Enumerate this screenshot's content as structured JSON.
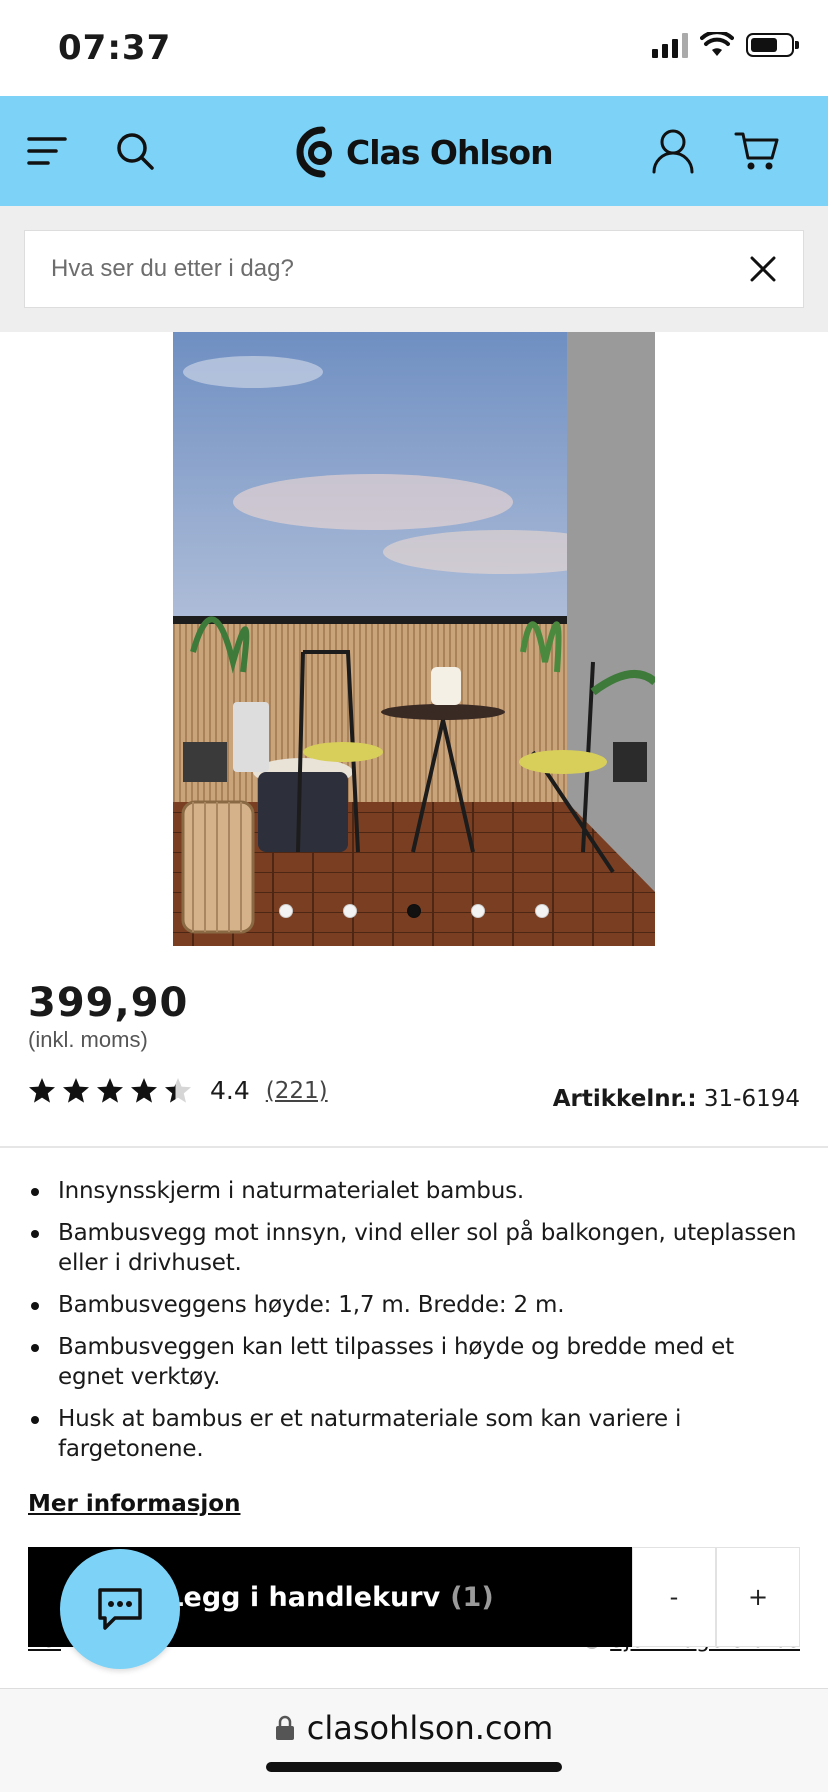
{
  "status_bar": {
    "time": "07:37"
  },
  "header": {
    "brand": "Clas Ohlson"
  },
  "search": {
    "placeholder": "Hva ser du etter i dag?"
  },
  "gallery": {
    "slide_count": 5,
    "active_index": 2
  },
  "product": {
    "price": "399,90",
    "vat_note": "(inkl. moms)",
    "rating": {
      "value": "4.4",
      "count": "(221)",
      "stars": 4.4
    },
    "article_label": "Artikkelnr.:",
    "article_number": "31-6194",
    "features": [
      "Innsynsskjerm i naturmaterialet bambus.",
      "Bambusvegg mot innsyn, vind eller sol på balkongen, uteplassen eller i drivhuset.",
      "Bambusveggens høyde: 1,7 m. Bredde: 2 m.",
      "Bambusveggen kan lett tilpasses i høyde og bredde med et egnet verktøy.",
      "Husk at bambus er et naturmateriale som kan variere i fargetonene."
    ],
    "more_info": "Mer informasjon"
  },
  "underlying_links": {
    "left": "Vel",
    "right": "Sjekk lagerstatus"
  },
  "cart": {
    "add_label": "Legg i handlekurv",
    "count": "(1)",
    "minus": "-",
    "plus": "+"
  },
  "browser": {
    "url": "clasohlson.com"
  },
  "colors": {
    "brand_blue": "#7cd3f7",
    "button_black": "#000000"
  }
}
